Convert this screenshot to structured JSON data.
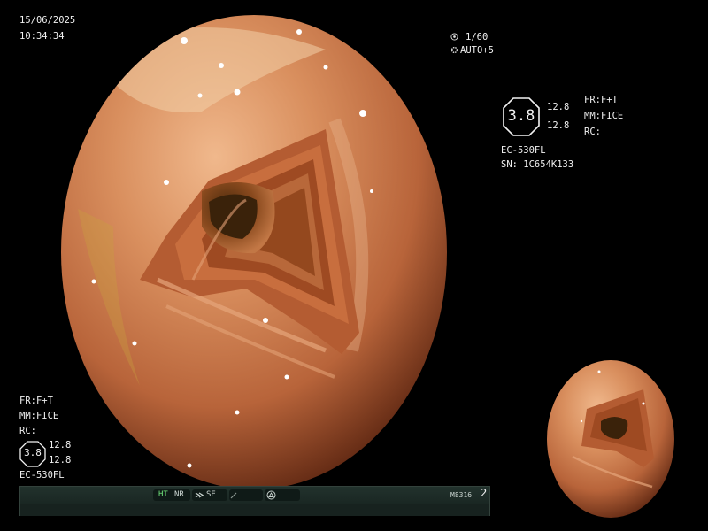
{
  "datetime": {
    "date": "15/06/2025",
    "time": "10:34:34"
  },
  "exposure": {
    "shutter": "1/60",
    "mode": "AUTO+5",
    "shutter_icon": "aperture-icon",
    "mode_icon": "gear-icon"
  },
  "right_panel": {
    "hex_value": "3.8",
    "value_top": "12.8",
    "value_bottom": "12.8",
    "fr": "FR:F+T",
    "mm": "MM:FICE",
    "rc": "RC:",
    "model": "EC-530FL",
    "serial": "SN: 1C654K133"
  },
  "left_panel": {
    "fr": "FR:F+T",
    "mm": "MM:FICE",
    "rc": "RC:",
    "hex_value": "3.8",
    "value_top": "12.8",
    "value_bottom": "12.8",
    "model": "EC-530FL"
  },
  "status_bar": {
    "ht": "HT",
    "nr": "NR",
    "se": "SE",
    "code": "M8316",
    "count": "2",
    "colors": {
      "active": "#6fe07a",
      "bg": "#1a2622"
    }
  }
}
